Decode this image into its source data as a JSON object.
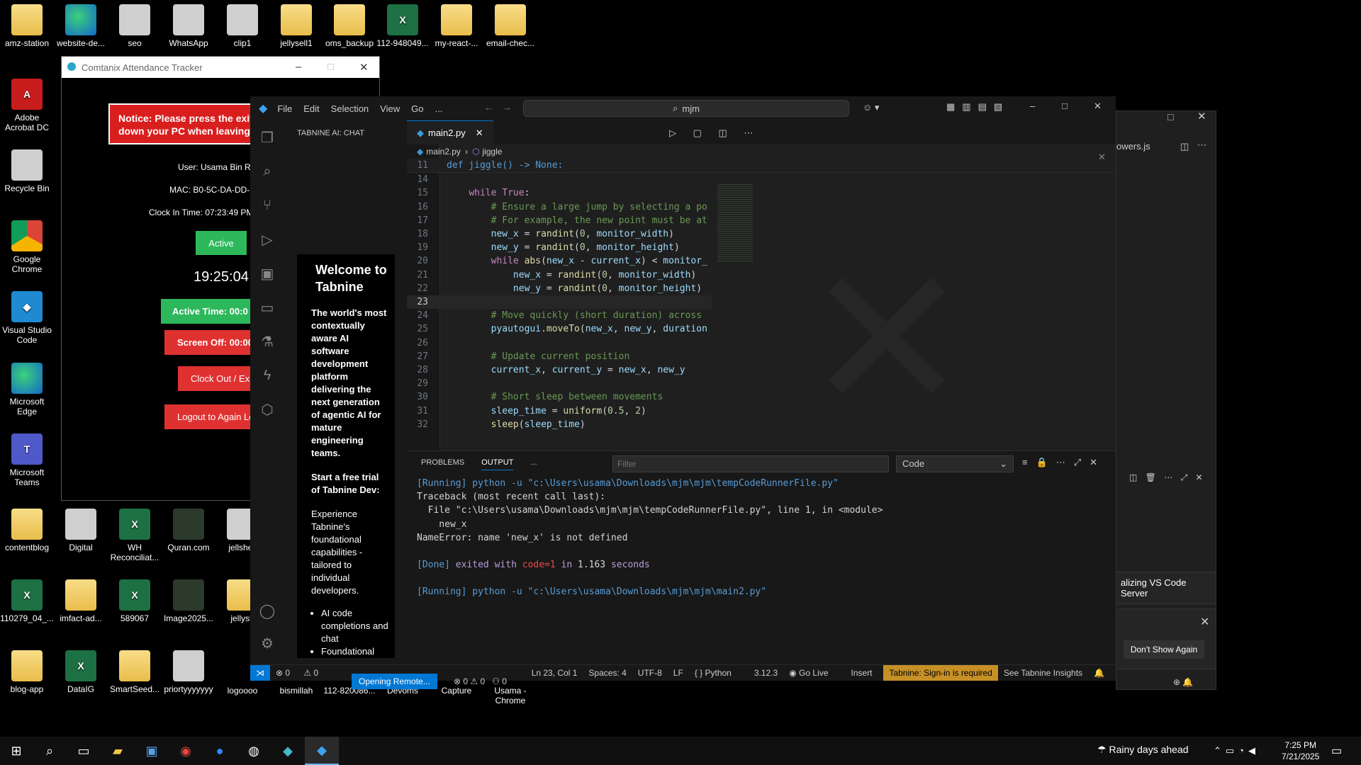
{
  "desktop": {
    "icons": [
      {
        "label": "amz-station",
        "kind": "folder"
      },
      {
        "label": "website-de...",
        "kind": "edge"
      },
      {
        "label": "seo",
        "kind": "gray"
      },
      {
        "label": "WhatsApp",
        "kind": "gray"
      },
      {
        "label": "clip1",
        "kind": "gray"
      },
      {
        "label": "jellysell1",
        "kind": "folder"
      },
      {
        "label": "oms_backup",
        "kind": "folder"
      },
      {
        "label": "112-948049...",
        "kind": "xl"
      },
      {
        "label": "my-react-...",
        "kind": "folder"
      },
      {
        "label": "email-chec...",
        "kind": "folder"
      },
      {
        "label": "Adobe Acrobat DC",
        "kind": "pdf"
      },
      {
        "label": "Recycle Bin",
        "kind": "gray"
      },
      {
        "label": "Google Chrome",
        "kind": "chrome"
      },
      {
        "label": "Visual Studio Code",
        "kind": "vsc"
      },
      {
        "label": "Microsoft Edge",
        "kind": "edge"
      },
      {
        "label": "Microsoft Teams",
        "kind": "teams"
      },
      {
        "label": "contentblog",
        "kind": "folder"
      },
      {
        "label": "Digital",
        "kind": "gray"
      },
      {
        "label": "WH Reconciliat...",
        "kind": "xl"
      },
      {
        "label": "Quran.com",
        "kind": "dark"
      },
      {
        "label": "jellshell",
        "kind": "gray"
      },
      {
        "label": "110279_04_...",
        "kind": "xl"
      },
      {
        "label": "imfact-ad...",
        "kind": "folder"
      },
      {
        "label": "589067",
        "kind": "xl"
      },
      {
        "label": "Image2025...",
        "kind": "dark"
      },
      {
        "label": "jellysh",
        "kind": "folder"
      },
      {
        "label": "blog-app",
        "kind": "folder"
      },
      {
        "label": "DataIG",
        "kind": "xl"
      },
      {
        "label": "SmartSeed...",
        "kind": "folder"
      },
      {
        "label": "priortyyyyyyy",
        "kind": "gray"
      },
      {
        "label": "logoooo",
        "kind": "gray"
      },
      {
        "label": "bismillah",
        "kind": "gray"
      },
      {
        "label": "112-820086...",
        "kind": "gray"
      },
      {
        "label": "Devoms",
        "kind": "gray"
      },
      {
        "label": "Capture",
        "kind": "gray"
      },
      {
        "label": "Usama - Chrome",
        "kind": "gray"
      }
    ]
  },
  "attendance": {
    "title": "Comtanix Attendance Tracker",
    "notice": "Notice: Please press the exit down your PC when leaving",
    "user": "User: Usama Bin Ra",
    "mac": "MAC: B0-5C-DA-DD-",
    "clock_in": "Clock In Time: 07:23:49 PM",
    "status_button": "Active",
    "clock": "19:25:04",
    "active_time": "Active Time: 00:0",
    "screen_off": "Screen Off: 00:00",
    "clock_out": "Clock Out / Exit",
    "logout": "Logout to Again Lo",
    "colors": {
      "notice": "#d91e1e",
      "active": "#2eb85c",
      "red": "#e03131"
    }
  },
  "vscode": {
    "menu": [
      "File",
      "Edit",
      "Selection",
      "View",
      "Go",
      "..."
    ],
    "search": "mjm",
    "sidebar_title": "TABNINE AI: CHAT",
    "tabnine": {
      "heading": "Welcome to Tabnine",
      "intro": "The world's most contextually aware AI software development platform delivering the next generation of agentic AI for mature engineering teams.",
      "trial": "Start a free trial of Tabnine Dev:",
      "desc": "Experience Tabnine's foundational capabilities - tailored to individual developers.",
      "bullets": [
        "AI code completions and chat",
        "Foundational"
      ]
    },
    "tab": "main2.py",
    "breadcrumb": [
      "main2.py",
      "jiggle"
    ],
    "sticky": {
      "num": "11",
      "text": "def jiggle() -> None:"
    },
    "code_lines": [
      {
        "n": "14",
        "t": ""
      },
      {
        "n": "15",
        "t": "    while True:"
      },
      {
        "n": "16",
        "t": "        # Ensure a large jump by selecting a po"
      },
      {
        "n": "17",
        "t": "        # For example, the new point must be at"
      },
      {
        "n": "18",
        "t": "        new_x = randint(0, monitor_width)"
      },
      {
        "n": "19",
        "t": "        new_y = randint(0, monitor_height)"
      },
      {
        "n": "20",
        "t": "        while abs(new_x - current_x) < monitor_"
      },
      {
        "n": "21",
        "t": "            new_x = randint(0, monitor_width)"
      },
      {
        "n": "22",
        "t": "            new_y = randint(0, monitor_height)"
      },
      {
        "n": "23",
        "t": ""
      },
      {
        "n": "24",
        "t": "        # Move quickly (short duration) across"
      },
      {
        "n": "25",
        "t": "        pyautogui.moveTo(new_x, new_y, duration"
      },
      {
        "n": "26",
        "t": ""
      },
      {
        "n": "27",
        "t": "        # Update current position"
      },
      {
        "n": "28",
        "t": "        current_x, current_y = new_x, new_y"
      },
      {
        "n": "29",
        "t": ""
      },
      {
        "n": "30",
        "t": "        # Short sleep between movements"
      },
      {
        "n": "31",
        "t": "        sleep_time = uniform(0.5, 2)"
      },
      {
        "n": "32",
        "t": "        sleep(sleep_time)"
      }
    ],
    "panel_tabs": [
      "PROBLEMS",
      "OUTPUT",
      "..."
    ],
    "filter_placeholder": "Filter",
    "output_channel": "Code",
    "output_lines": [
      "[Running] python -u \"c:\\Users\\usama\\Downloads\\mjm\\mjm\\tempCodeRunnerFile.py\"",
      "Traceback (most recent call last):",
      "  File \"c:\\Users\\usama\\Downloads\\mjm\\mjm\\tempCodeRunnerFile.py\", line 1, in <module>",
      "    new_x",
      "NameError: name 'new_x' is not defined",
      "",
      "[Done] exited with code=1 in 1.163 seconds",
      "",
      "[Running] python -u \"c:\\Users\\usama\\Downloads\\mjm\\mjm\\main2.py\""
    ],
    "status": {
      "errors": "0",
      "warnings": "0",
      "position": "Ln 23, Col 1",
      "spaces": "Spaces: 4",
      "encoding": "UTF-8",
      "eol": "LF",
      "language": "Python",
      "version": "3.12.3",
      "golive": "Go Live",
      "insert": "Insert",
      "tabnine": "Tabnine: Sign-in is required",
      "insights": "See Tabnine Insights"
    }
  },
  "vscode_bg": {
    "tab": "owers.js",
    "notification": "alizing VS Code Server",
    "dont_show": "Don't Show Again",
    "remote": "Opening Remote...",
    "errors": "0",
    "warnings": "0",
    "ports": "0"
  },
  "taskbar": {
    "weather": "Rainy days ahead",
    "time": "7:25 PM",
    "date": "7/21/2025"
  }
}
